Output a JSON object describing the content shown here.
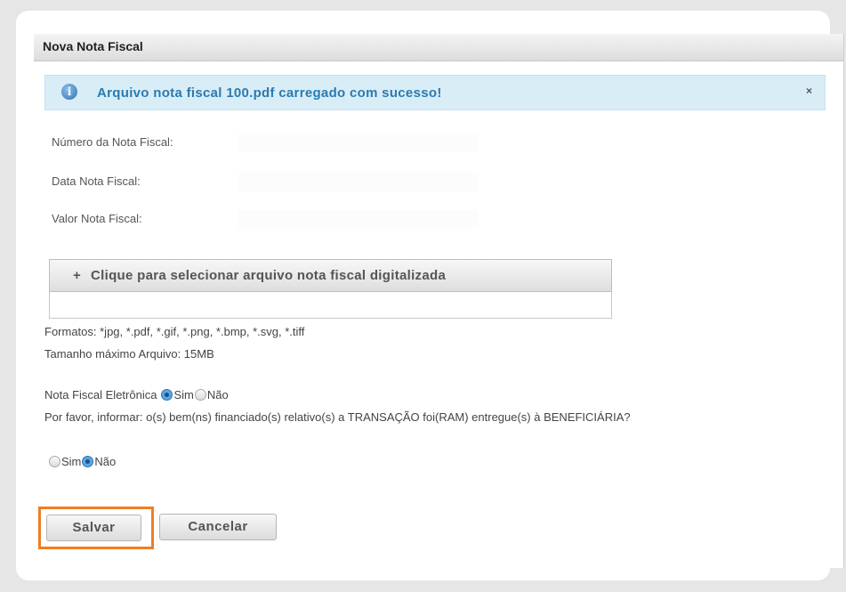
{
  "dialog": {
    "title": "Nova Nota Fiscal"
  },
  "alert": {
    "icon": "info-icon",
    "message": "Arquivo nota fiscal 100.pdf carregado com sucesso!",
    "close": "×"
  },
  "form": {
    "numero_label": "Número da Nota Fiscal:",
    "data_label": "Data Nota Fiscal:",
    "valor_label": "Valor Nota Fiscal:"
  },
  "upload": {
    "plus": "+",
    "label": "Clique para selecionar arquivo nota fiscal digitalizada",
    "formats": "Formatos: *jpg, *.pdf, *.gif, *.png, *.bmp, *.svg, *.tiff",
    "max_size": "Tamanho máximo Arquivo: 15MB"
  },
  "eletronica": {
    "label": "Nota Fiscal Eletrônica",
    "options": [
      "Sim",
      "Não"
    ],
    "selected": "Sim"
  },
  "entrega": {
    "question": "Por favor, informar: o(s) bem(ns) financiado(s) relativo(s) a TRANSAÇÃO foi(RAM) entregue(s) à BENEFICIÁRIA?",
    "options": [
      "Sim",
      "Não"
    ],
    "selected": "Não"
  },
  "buttons": {
    "save": "Salvar",
    "cancel": "Cancelar"
  },
  "colors": {
    "alert_bg": "#d9edf7",
    "alert_text": "#2a7bb0",
    "highlight": "#f07e22"
  }
}
